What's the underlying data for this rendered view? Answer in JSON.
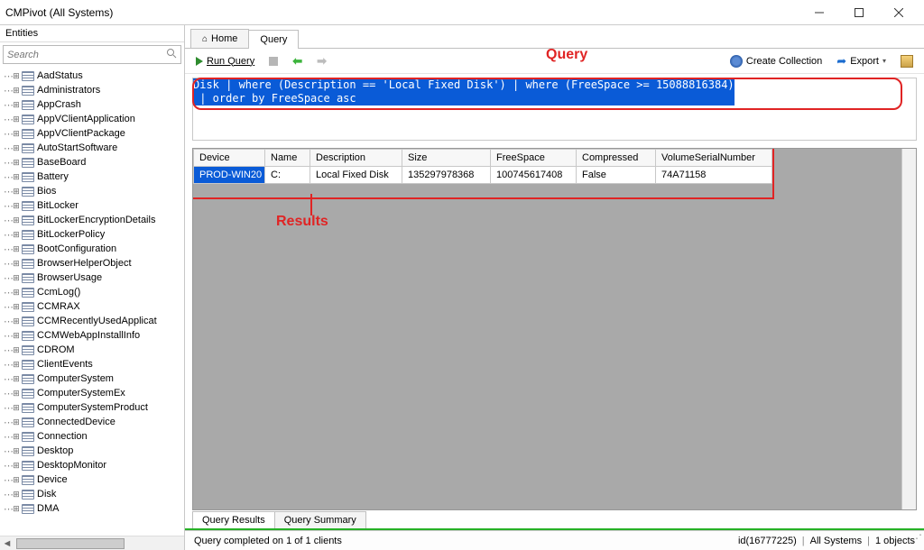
{
  "window": {
    "title": "CMPivot (All Systems)"
  },
  "sidebar": {
    "title": "Entities",
    "search_placeholder": "Search",
    "items": [
      "AadStatus",
      "Administrators",
      "AppCrash",
      "AppVClientApplication",
      "AppVClientPackage",
      "AutoStartSoftware",
      "BaseBoard",
      "Battery",
      "Bios",
      "BitLocker",
      "BitLockerEncryptionDetails",
      "BitLockerPolicy",
      "BootConfiguration",
      "BrowserHelperObject",
      "BrowserUsage",
      "CcmLog()",
      "CCMRAX",
      "CCMRecentlyUsedApplicat",
      "CCMWebAppInstallInfo",
      "CDROM",
      "ClientEvents",
      "ComputerSystem",
      "ComputerSystemEx",
      "ComputerSystemProduct",
      "ConnectedDevice",
      "Connection",
      "Desktop",
      "DesktopMonitor",
      "Device",
      "Disk",
      "DMA"
    ]
  },
  "tabs": {
    "home": "Home",
    "query": "Query"
  },
  "toolbar": {
    "run": "Run Query",
    "create_collection": "Create Collection",
    "export": "Export"
  },
  "query": {
    "text": "Disk | where (Description == 'Local Fixed Disk') | where (FreeSpace >= 15088816384)\n | order by FreeSpace asc"
  },
  "annotations": {
    "query": "Query",
    "results": "Results"
  },
  "results": {
    "columns": [
      "Device",
      "Name",
      "Description",
      "Size",
      "FreeSpace",
      "Compressed",
      "VolumeSerialNumber"
    ],
    "rows": [
      {
        "Device": "PROD-WIN20",
        "Name": "C:",
        "Description": "Local Fixed Disk",
        "Size": "135297978368",
        "FreeSpace": "100745617408",
        "Compressed": "False",
        "VolumeSerialNumber": "74A71158"
      }
    ]
  },
  "bottom_tabs": {
    "results": "Query Results",
    "summary": "Query Summary"
  },
  "status": {
    "message": "Query completed on 1 of 1 clients",
    "id": "id(16777225)",
    "collection": "All Systems",
    "objects": "1 objects"
  }
}
